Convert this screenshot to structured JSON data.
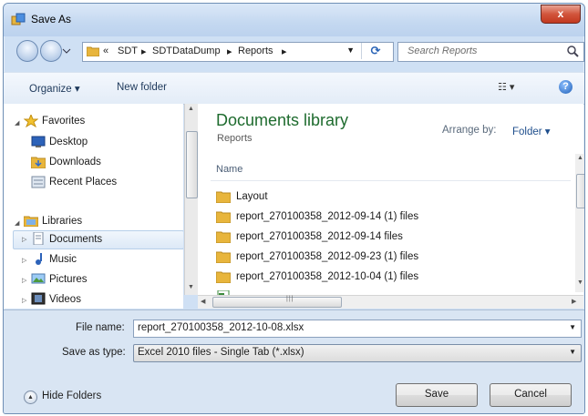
{
  "window": {
    "title": "Save As",
    "close_label": "x"
  },
  "address": {
    "crumbs": [
      "«",
      "SDT",
      "▸",
      "SDTDataDump",
      "▸",
      "Reports",
      "▸"
    ],
    "search_placeholder": "Search Reports"
  },
  "toolbar": {
    "organize": "Organize ▾",
    "new_folder": "New folder"
  },
  "nav": {
    "favorites": "Favorites",
    "desktop": "Desktop",
    "downloads": "Downloads",
    "recent": "Recent Places",
    "libraries": "Libraries",
    "documents": "Documents",
    "music": "Music",
    "pictures": "Pictures",
    "videos": "Videos"
  },
  "content": {
    "library_title": "Documents library",
    "library_sub": "Reports",
    "arrange_label": "Arrange by:",
    "arrange_value": "Folder ▾",
    "column_name": "Name",
    "files": [
      "Layout",
      "report_270100358_2012-09-14 (1) files",
      "report_270100358_2012-09-14 files",
      "report_270100358_2012-09-23 (1) files",
      "report_270100358_2012-10-04 (1) files"
    ]
  },
  "form": {
    "file_name_label": "File name:",
    "file_name_value": "report_270100358_2012-10-08.xlsx",
    "type_label": "Save as type:",
    "type_value": "Excel 2010 files - Single Tab (*.xlsx)",
    "hide_folders": "Hide Folders",
    "save": "Save",
    "cancel": "Cancel"
  },
  "colors": {
    "library_title": "#1e6b2e",
    "folder": "#e8b53c",
    "close": "#c2391f"
  }
}
